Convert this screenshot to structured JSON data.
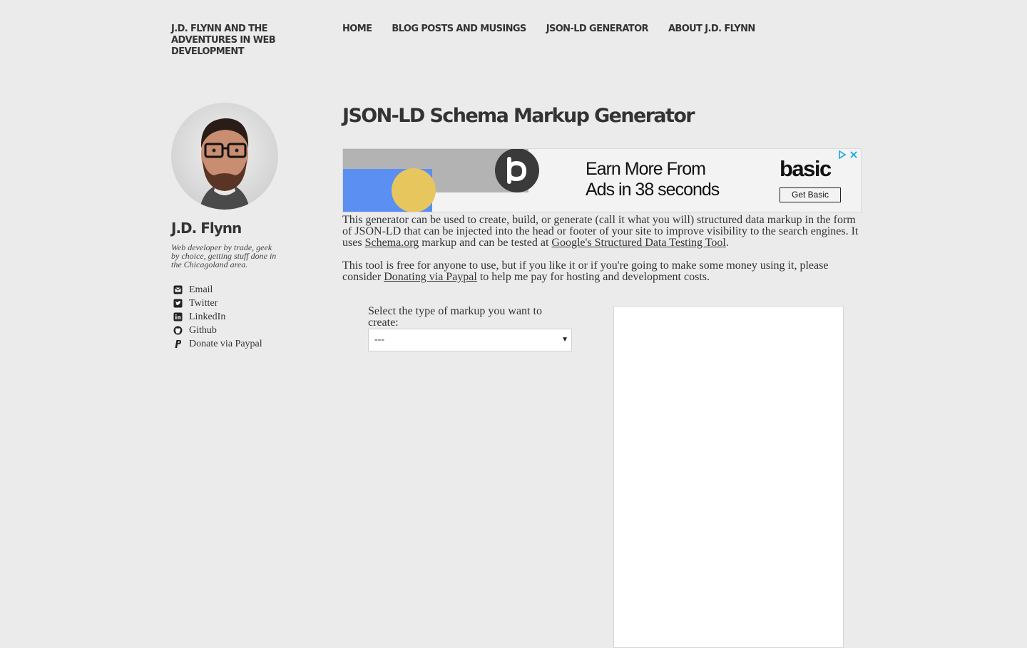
{
  "site": {
    "title": "J.D. Flynn and the Adventures in Web Development"
  },
  "nav": [
    {
      "label": "Home"
    },
    {
      "label": "Blog Posts and Musings"
    },
    {
      "label": "JSON-LD Generator"
    },
    {
      "label": "About J.D. Flynn"
    }
  ],
  "sidebar": {
    "name": "J.D. Flynn",
    "bio": "Web developer by trade, geek by choice, getting stuff done in the Chicagoland area.",
    "links": [
      {
        "label": "Email",
        "icon": "envelope-icon"
      },
      {
        "label": "Twitter",
        "icon": "twitter-icon"
      },
      {
        "label": "LinkedIn",
        "icon": "linkedin-icon"
      },
      {
        "label": "Github",
        "icon": "github-icon"
      },
      {
        "label": "Donate via Paypal",
        "icon": "paypal-icon"
      }
    ]
  },
  "main": {
    "title": "JSON-LD Schema Markup Generator",
    "intro": {
      "p1_text": "This generator can be used to create, build, or generate (call it what you will) structured data markup in the form of JSON-LD that can be injected into the head or footer of your site to improve visibility to the search engines. It uses ",
      "p1_link1": "Schema.org",
      "p1_mid": " markup and can be tested at ",
      "p1_link2": "Google's Structured Data Testing Tool",
      "p1_end": ".",
      "p2_text": "This tool is free for anyone to use, but if you like it or if you're going to make some money using it, please consider ",
      "p2_link": "Donating via Paypal",
      "p2_end": " to help me pay for hosting and development costs."
    },
    "select": {
      "label": "Select the type of markup you want to create:",
      "value": "---"
    }
  },
  "ad": {
    "headline_line1": "Earn More From",
    "headline_line2": "Ads in 38 seconds",
    "brand": "basic",
    "cta": "Get Basic",
    "colors": {
      "blue": "#5b8ff2",
      "yellow": "#e8c65e",
      "gray_bar": "#b3b3b3",
      "logo_circle": "#3a3a3a",
      "adchoices": "#14a7e0"
    }
  }
}
